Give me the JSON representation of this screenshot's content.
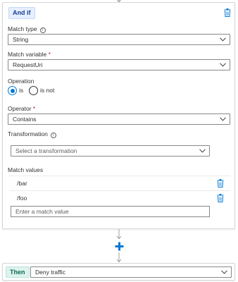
{
  "condition": {
    "tag_label": "And if",
    "match_type": {
      "label": "Match type",
      "value": "String"
    },
    "match_variable": {
      "label": "Match variable",
      "required_mark": "*",
      "value": "RequestUri"
    },
    "operation": {
      "label": "Operation",
      "options": [
        "is",
        "is not"
      ],
      "selected": "is"
    },
    "operator": {
      "label": "Operator",
      "required_mark": "*",
      "value": "Contains"
    },
    "transformation": {
      "label": "Transformation",
      "placeholder": "Select a transformation"
    },
    "match_values": {
      "label": "Match values",
      "items": [
        "/bar",
        "/foo"
      ],
      "input_placeholder": "Enter a match value"
    }
  },
  "action": {
    "tag_label": "Then",
    "value": "Deny traffic"
  },
  "icons": {
    "delete": "trash-icon",
    "info": "info-icon",
    "expand": "chevron-down-icon",
    "add": "plus-icon",
    "flow": "arrow-down-icon"
  },
  "colors": {
    "accent": "#0078d4",
    "required": "#a4262c",
    "if_tag_bg": "#e6efff",
    "then_tag_bg": "#def3ee"
  }
}
